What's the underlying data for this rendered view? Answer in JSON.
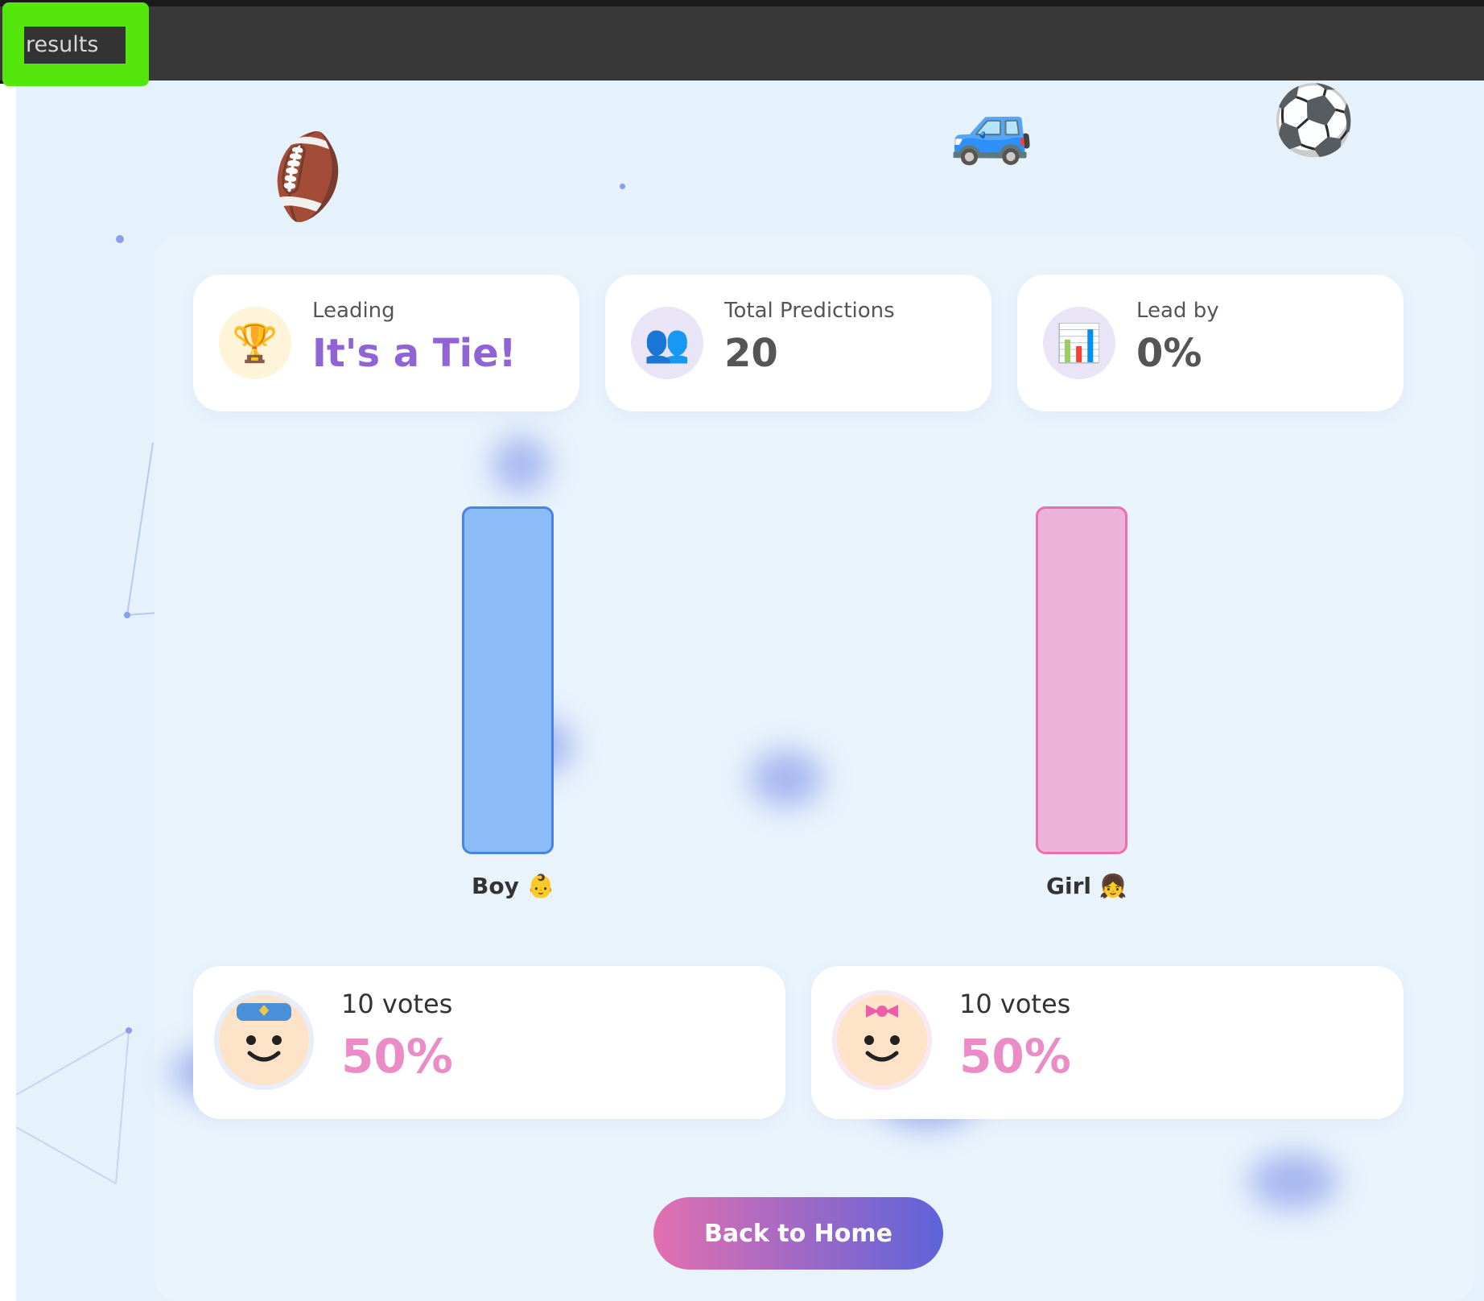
{
  "tab": {
    "label": "results"
  },
  "stats": [
    {
      "label": "Leading",
      "value": "It's a Tie!",
      "icon": "trophy-icon",
      "icon_glyph": "🏆",
      "value_color": "#9063d6"
    },
    {
      "label": "Total Predictions",
      "value": "20",
      "icon": "people-icon",
      "icon_glyph": "👥",
      "value_color": "#555555"
    },
    {
      "label": "Lead by",
      "value": "0%",
      "icon": "bar-chart-icon",
      "icon_glyph": "📊",
      "value_color": "#555555"
    }
  ],
  "chart_data": {
    "type": "bar",
    "categories": [
      "Boy 👶",
      "Girl 👧"
    ],
    "values": [
      10,
      10
    ],
    "colors": [
      "#8bbcf7",
      "#edb2d9"
    ]
  },
  "votes": [
    {
      "count": "10 votes",
      "percent": "50%"
    },
    {
      "count": "10 votes",
      "percent": "50%"
    }
  ],
  "actions": {
    "home_label": "Back to Home"
  },
  "decor_icons": [
    "football-icon",
    "car-icon",
    "soccer-ball-icon"
  ]
}
